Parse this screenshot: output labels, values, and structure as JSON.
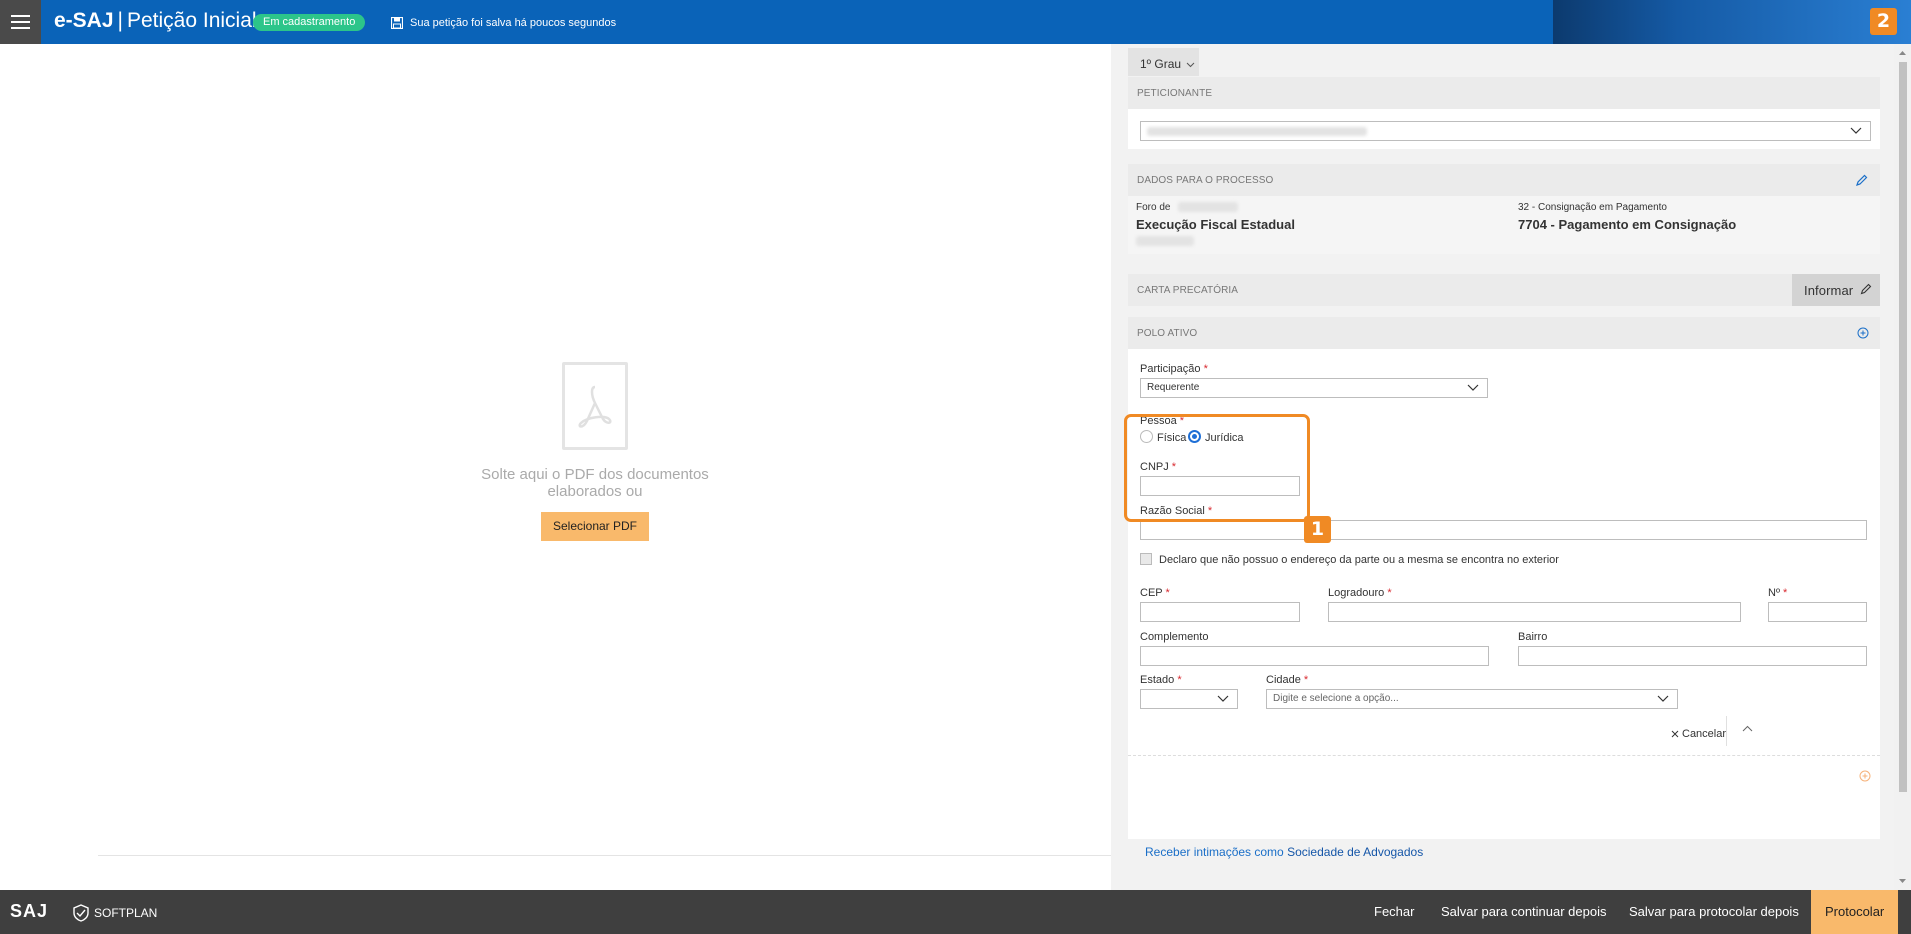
{
  "header": {
    "app_name": "e-SAJ",
    "separator": "|",
    "page_title": "Petição Inicial",
    "status_badge": "Em cadastramento",
    "save_note": "Sua petição foi salva há poucos segundos"
  },
  "annotations": [
    "1",
    "2"
  ],
  "drop_zone": {
    "text_line1": "Solte aqui o PDF dos documentos",
    "text_line2": "elaborados ou",
    "button": "Selecionar PDF"
  },
  "panel": {
    "grau_tab": "1º Grau",
    "peticionante": {
      "heading": "PETICIONANTE"
    },
    "dados_processo": {
      "heading": "DADOS PARA O PROCESSO",
      "foro_label": "Foro de",
      "foro_name": "Execução Fiscal Estadual",
      "classe_code": "32 - Consignação em Pagamento",
      "assunto": "7704 - Pagamento em Consignação"
    },
    "carta_precatoria": {
      "heading": "CARTA PRECATÓRIA",
      "button": "Informar"
    },
    "polo_ativo": {
      "heading": "POLO ATIVO",
      "participacao_label": "Participação",
      "participacao_value": "Requerente",
      "pessoa_label": "Pessoa",
      "pessoa_options": [
        "Física",
        "Jurídica"
      ],
      "pessoa_selected": "Jurídica",
      "cnpj_label": "CNPJ",
      "razao_social_label": "Razão Social",
      "declaro_label": "Declaro que não possuo o endereço da parte ou a mesma se encontra no exterior",
      "cep_label": "CEP",
      "logradouro_label": "Logradouro",
      "numero_label": "Nº",
      "complemento_label": "Complemento",
      "bairro_label": "Bairro",
      "estado_label": "Estado",
      "cidade_label": "Cidade",
      "cidade_placeholder": "Digite e selecione a opção...",
      "cancel_label": "Cancelar",
      "required_mark": "*"
    },
    "intimacoes": {
      "prefix": "Receber intimações como",
      "link": "Sociedade de Advogados"
    }
  },
  "footer": {
    "logo_saj": "SAJ",
    "logo_softplan": "SOFTPLAN",
    "buttons": [
      "Fechar",
      "Salvar para continuar depois",
      "Salvar para protocolar depois",
      "Protocolar"
    ]
  },
  "colors": {
    "topbar": "#0a63b8",
    "badge_green": "#2cc58a",
    "accent_orange": "#f08a24",
    "button_orange": "#f9b96b",
    "footer": "#3f3f3f",
    "link_blue": "#1b6fc8"
  }
}
